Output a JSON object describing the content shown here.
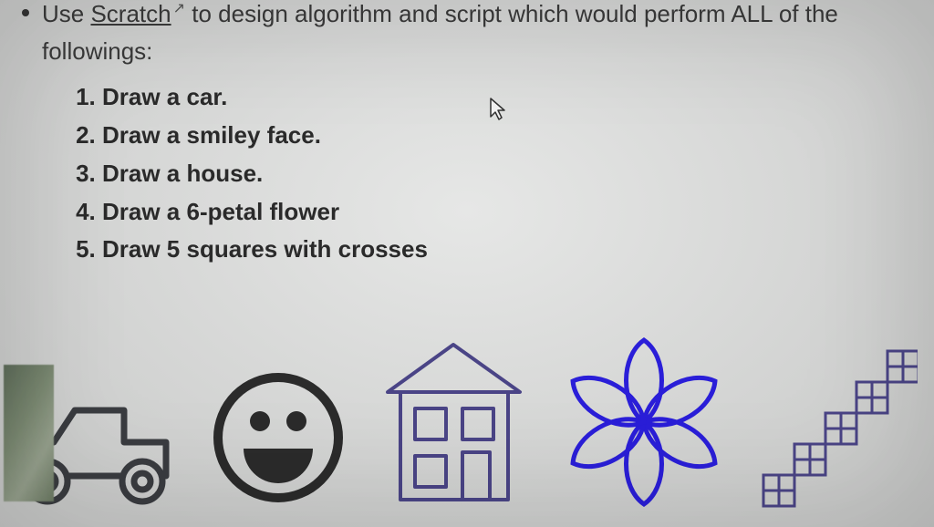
{
  "intro": {
    "prefix": "Use ",
    "link_text": "Scratch",
    "external_icon": "↗",
    "suffix": " to design algorithm and script which would perform ALL of the",
    "followings": "followings:"
  },
  "steps": [
    "Draw a car.",
    "Draw a smiley face.",
    "Draw a house.",
    "Draw a 6-petal flower",
    "Draw 5 squares with crosses"
  ],
  "illustrations": {
    "car": "car-drawing",
    "smiley": "smiley-face-drawing",
    "house": "house-drawing",
    "flower": "six-petal-flower-drawing",
    "squares": "five-squares-with-crosses-drawing"
  },
  "colors": {
    "text": "#2a2a2a",
    "car_stroke": "#3a3c40",
    "smiley_stroke": "#2b2b2b",
    "house_stroke": "#4a4486",
    "flower_stroke": "#2a1ed8",
    "squares_stroke": "#4a4486"
  }
}
